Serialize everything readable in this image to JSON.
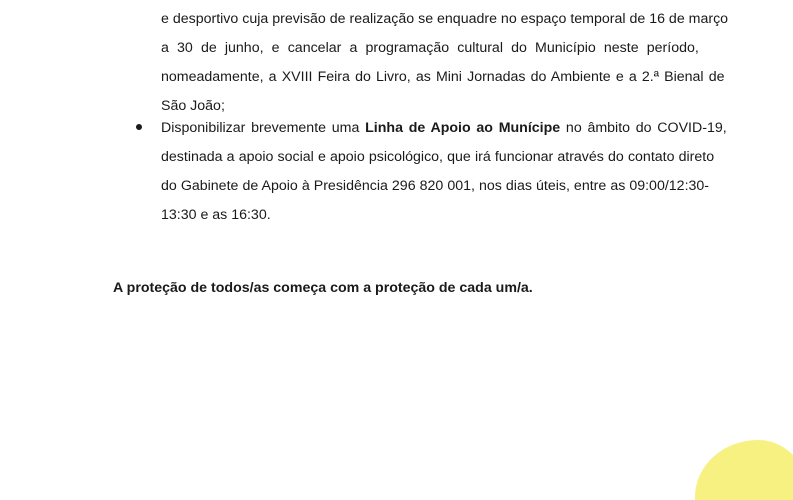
{
  "paragraph_continuation": {
    "line1": "e desportivo cuja previsão de realização se enquadre no espaço temporal de 16 de março",
    "line2": "a 30 de junho, e cancelar a programação cultural do Município neste período,",
    "line3": "nomeadamente, a XVIII Feira do Livro, as Mini Jornadas do Ambiente e a 2.ª Bienal de",
    "line4": "São João;"
  },
  "bullet_item": {
    "prefix": "Disponibilizar brevemente uma ",
    "bold_phrase": "Linha de Apoio ao Munícipe",
    "suffix": " no âmbito do COVID-19,",
    "line2": "destinada a apoio social e apoio psicológico, que irá funcionar através do contato direto",
    "line3": "do Gabinete de Apoio à Presidência 296 820 001, nos dias úteis, entre as 09:00/12:30-",
    "line4": "13:30 e as 16:30."
  },
  "closing_statement": "A proteção de todos/as começa com a proteção de cada um/a.",
  "colors": {
    "text": "#1a1a1a",
    "logo_accent": "#f5ee6a"
  }
}
